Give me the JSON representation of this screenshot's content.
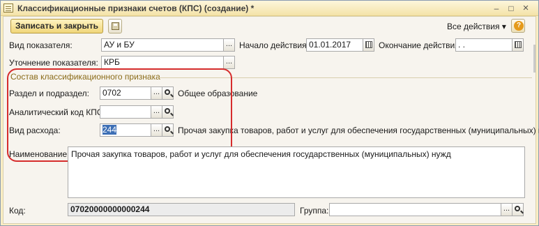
{
  "window": {
    "title": "Классификационные признаки счетов (КПС) (создание) *",
    "minimize": "–",
    "maximize": "□",
    "close": "×"
  },
  "toolbar": {
    "save_close": "Записать и закрыть",
    "all_actions": "Все действия",
    "dropdown_arrow": "▾",
    "help": "?"
  },
  "fields": {
    "vid_pokazatelya": {
      "label": "Вид показателя:",
      "value": "АУ и БУ"
    },
    "nachalo": {
      "label": "Начало действия:",
      "value": "01.01.2017"
    },
    "okonchanie": {
      "label": "Окончание действия:",
      "value": " .  . "
    },
    "utochnenie": {
      "label": "Уточнение показателя:",
      "value": "КРБ"
    }
  },
  "group": {
    "title": "Состав классификационного признака",
    "razdel": {
      "label": "Раздел и подраздел:",
      "value": "0702",
      "description": "Общее образование"
    },
    "analitika": {
      "label": "Аналитический код КПС:",
      "value": ""
    },
    "vid_rashoda": {
      "label": "Вид расхода:",
      "value": "244",
      "description": "Прочая закупка товаров, работ и услуг для обеспечения государственных (муниципальных) нужд"
    }
  },
  "naimenovanie": {
    "label": "Наименование:",
    "value": "Прочая закупка товаров, работ и услуг для обеспечения государственных (муниципальных) нужд"
  },
  "kod": {
    "label": "Код:",
    "value": "07020000000000244"
  },
  "gruppa": {
    "label": "Группа:",
    "value": ""
  },
  "select_button": "...",
  "colors": {
    "highlight": "#d62c2c",
    "primary_button": "#f0d67a",
    "window_bg": "#fbeec4"
  },
  "icons": [
    "calendar-icon",
    "search-icon",
    "save-icon",
    "help-icon"
  ]
}
